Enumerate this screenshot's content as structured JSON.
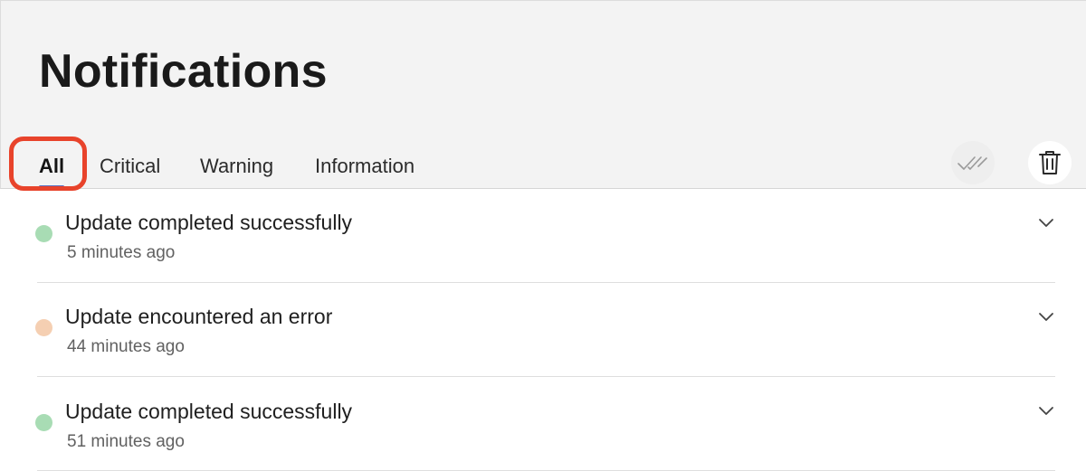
{
  "header": {
    "title": "Notifications"
  },
  "tabs": [
    {
      "label": "All",
      "active": true
    },
    {
      "label": "Critical",
      "active": false
    },
    {
      "label": "Warning",
      "active": false
    },
    {
      "label": "Information",
      "active": false
    }
  ],
  "toolbar": {
    "mark_all_read_icon": "double-check-icon",
    "delete_icon": "trash-icon"
  },
  "notifications": [
    {
      "title": "Update completed successfully",
      "time": "5 minutes ago",
      "status": "success",
      "status_color": "#a8dcb4"
    },
    {
      "title": "Update encountered an error",
      "time": "44 minutes ago",
      "status": "warning",
      "status_color": "#f5cfb2"
    },
    {
      "title": "Update completed successfully",
      "time": "51 minutes ago",
      "status": "success",
      "status_color": "#a8dcb4"
    }
  ],
  "colors": {
    "highlight_ring": "#e8432b",
    "active_tab_indicator": "#5a6fbf",
    "header_background": "#f3f3f3"
  }
}
